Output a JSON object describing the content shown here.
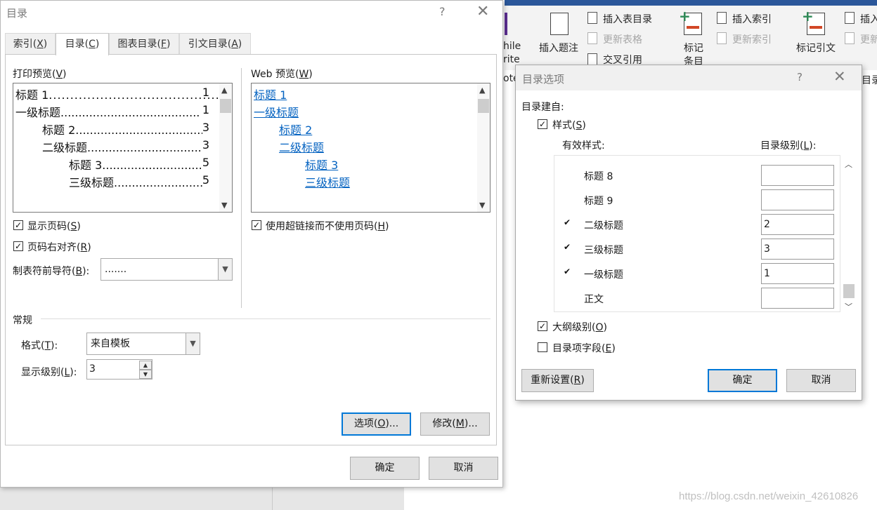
{
  "ribbon": {
    "partial_top": "hile",
    "partial_mid": "rite",
    "partial_bot": "ote",
    "insert_caption": "插入题注",
    "insert_table_of_figures": "插入表目录",
    "update_table": "更新表格",
    "cross_reference": "交叉引用",
    "mark_entry_line1": "标记",
    "mark_entry_line2": "条目",
    "insert_index": "插入索引",
    "update_index": "更新索引",
    "mark_citation": "标记引文",
    "insert_partial": "插入",
    "update_partial": "更新",
    "toc_partial": "目录"
  },
  "watermark": "https://blog.csdn.net/weixin_42610826",
  "toc_dialog": {
    "title": "目录",
    "help": "?",
    "close": "✕",
    "tabs": [
      {
        "label": "索引(",
        "key": "X",
        "tail": ")"
      },
      {
        "label": "目录(",
        "key": "C",
        "tail": ")"
      },
      {
        "label": "图表目录(",
        "key": "F",
        "tail": ")"
      },
      {
        "label": "引文目录(",
        "key": "A",
        "tail": ")"
      }
    ],
    "active_tab": 1,
    "print_preview": {
      "label": "打印预览(",
      "key": "V",
      "tail": ")",
      "lines": [
        {
          "text": "标题 1",
          "page": "1"
        },
        {
          "text": "一级标题",
          "page": "1"
        },
        {
          "text": "标题 2",
          "page": "3"
        },
        {
          "text": "二级标题",
          "page": "3"
        },
        {
          "text": "标题 3",
          "page": "5"
        },
        {
          "text": "三级标题",
          "page": "5"
        }
      ]
    },
    "web_preview": {
      "label": "Web 预览(",
      "key": "W",
      "tail": ")",
      "links": [
        "标题 1",
        "一级标题",
        "标题 2",
        "二级标题",
        "标题 3",
        "三级标题"
      ]
    },
    "show_page_numbers": {
      "label": "显示页码(",
      "key": "S",
      "tail": ")",
      "checked": true
    },
    "right_align": {
      "label": "页码右对齐(",
      "key": "R",
      "tail": ")",
      "checked": true
    },
    "use_hyperlinks": {
      "label": "使用超链接而不使用页码(",
      "key": "H",
      "tail": ")",
      "checked": true
    },
    "tab_leader": {
      "label": "制表符前导符(",
      "key": "B",
      "tail": "):",
      "value": "......."
    },
    "general": {
      "title": "常规",
      "format": {
        "label": "格式(",
        "key": "T",
        "tail": "):",
        "value": "来自模板"
      },
      "levels": {
        "label": "显示级别(",
        "key": "L",
        "tail": "):",
        "value": "3"
      }
    },
    "options_button": {
      "label": "选项(",
      "key": "O",
      "tail": ")..."
    },
    "modify_button": {
      "label": "修改(",
      "key": "M",
      "tail": ")..."
    },
    "ok": "确定",
    "cancel": "取消"
  },
  "options_dialog": {
    "title": "目录选项",
    "help": "?",
    "close": "✕",
    "build_from": "目录建自:",
    "styles": {
      "label": "样式(",
      "key": "S",
      "tail": ")",
      "checked": true
    },
    "available_styles": "有效样式:",
    "toc_level": {
      "label": "目录级别(",
      "key": "L",
      "tail": "):"
    },
    "rows": [
      {
        "name": "标题 8",
        "level": "",
        "checked": false
      },
      {
        "name": "标题 9",
        "level": "",
        "checked": false
      },
      {
        "name": "二级标题",
        "level": "2",
        "checked": true
      },
      {
        "name": "三级标题",
        "level": "3",
        "checked": true
      },
      {
        "name": "一级标题",
        "level": "1",
        "checked": true
      },
      {
        "name": "正文",
        "level": "",
        "checked": false
      }
    ],
    "outline_levels": {
      "label": "大纲级别(",
      "key": "O",
      "tail": ")",
      "checked": true
    },
    "toc_entry_fields": {
      "label": "目录项字段(",
      "key": "E",
      "tail": ")",
      "checked": false
    },
    "reset": {
      "label": "重新设置(",
      "key": "R",
      "tail": ")"
    },
    "ok": "确定",
    "cancel": "取消"
  }
}
